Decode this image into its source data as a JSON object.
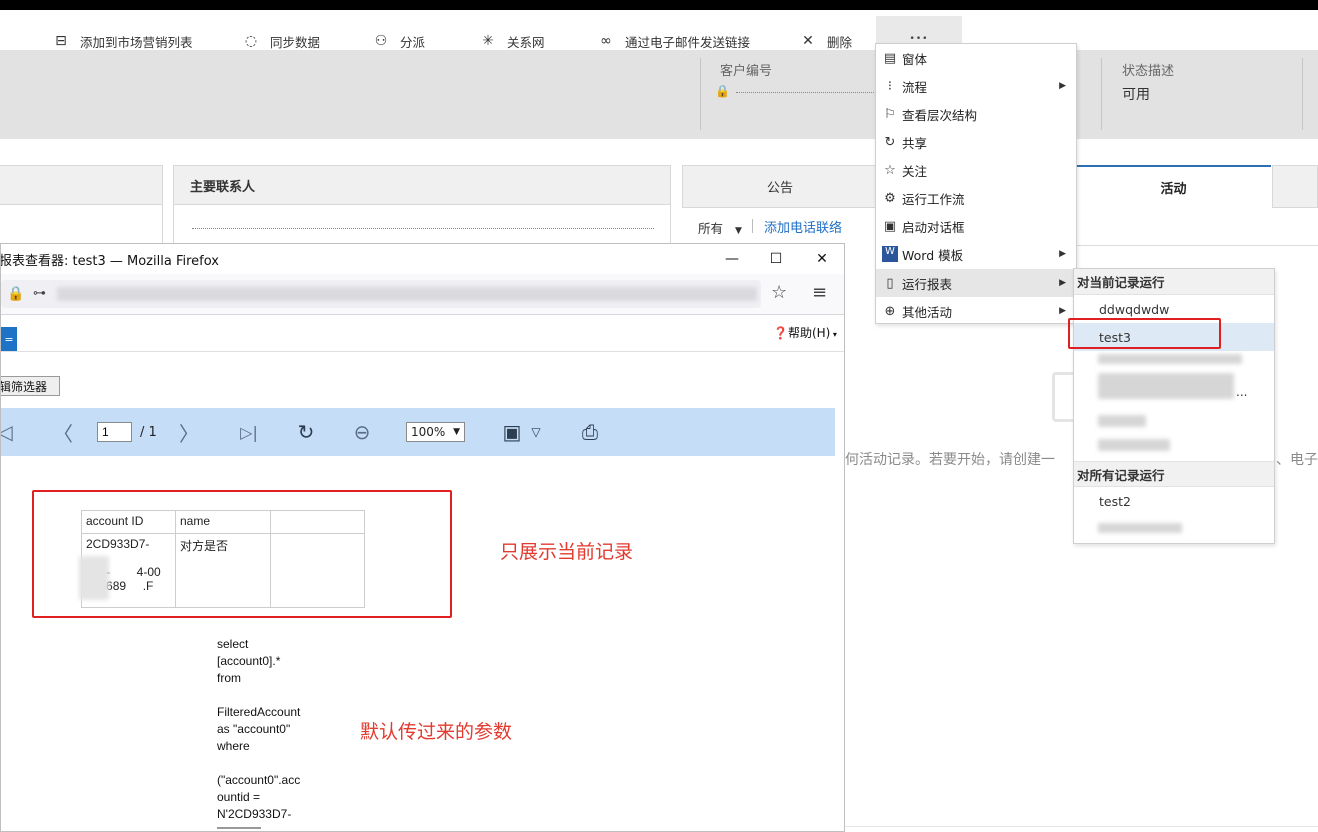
{
  "commandbar": {
    "add_to_list": "添加到市场营销列表",
    "sync": "同步数据",
    "assign": "分派",
    "relation": "关系网",
    "email_link": "通过电子邮件发送链接",
    "delete": "删除",
    "more": "•••"
  },
  "header": {
    "customer_no_label": "客户编号",
    "status_label": "状态描述",
    "status_value": "可用"
  },
  "panels": {
    "primary_contact": "主要联系人",
    "announce_tab": "公告",
    "activity_tab": "活动",
    "filter_all": "所有",
    "add_phone": "添加电话联络",
    "empty_text": "何活动记录。若要开始，请创建一",
    "empty_tail": "、电子"
  },
  "dropdown": {
    "items": [
      {
        "icon": "form-icon",
        "label": "窗体",
        "arrow": false
      },
      {
        "icon": "process-icon",
        "label": "流程",
        "arrow": true
      },
      {
        "icon": "hierarchy-icon",
        "label": "查看层次结构",
        "arrow": false
      },
      {
        "icon": "share-icon",
        "label": "共享",
        "arrow": false
      },
      {
        "icon": "star-icon",
        "label": "关注",
        "arrow": false
      },
      {
        "icon": "workflow-icon",
        "label": "运行工作流",
        "arrow": false
      },
      {
        "icon": "dialog-icon",
        "label": "启动对话框",
        "arrow": false
      },
      {
        "icon": "word-icon",
        "label": "Word 模板",
        "arrow": true
      },
      {
        "icon": "report-icon",
        "label": "运行报表",
        "arrow": true
      },
      {
        "icon": "other-activity-icon",
        "label": "其他活动",
        "arrow": true
      }
    ]
  },
  "submenu": {
    "current_head": "对当前记录运行",
    "item1": "ddwqdwdw",
    "item2": "test3",
    "ellipsis": "...",
    "all_head": "对所有记录运行",
    "item3": "test2"
  },
  "firefox": {
    "title": "报表查看器: test3 — Mozilla Firefox",
    "min": "—",
    "max": "☐",
    "close": "✕",
    "help": "帮助(H)",
    "tab_char": "=",
    "filter_btn": "辑筛选器",
    "page_value": "1",
    "page_total": "/ 1",
    "zoom": "100%"
  },
  "report": {
    "col1": "account ID",
    "col2": "name",
    "cell1": "2CD933D7-\n\n      -        4-00\n505689     .F",
    "cell2": "对方是否",
    "sql": "select\n[account0].*\nfrom\n\nFilteredAccount\nas \"account0\"\nwhere\n\n(\"account0\".acc\nountid =\nN'2CD933D7-"
  },
  "annotations": {
    "current_only": "只展示当前记录",
    "default_param": "默认传过来的参数"
  }
}
